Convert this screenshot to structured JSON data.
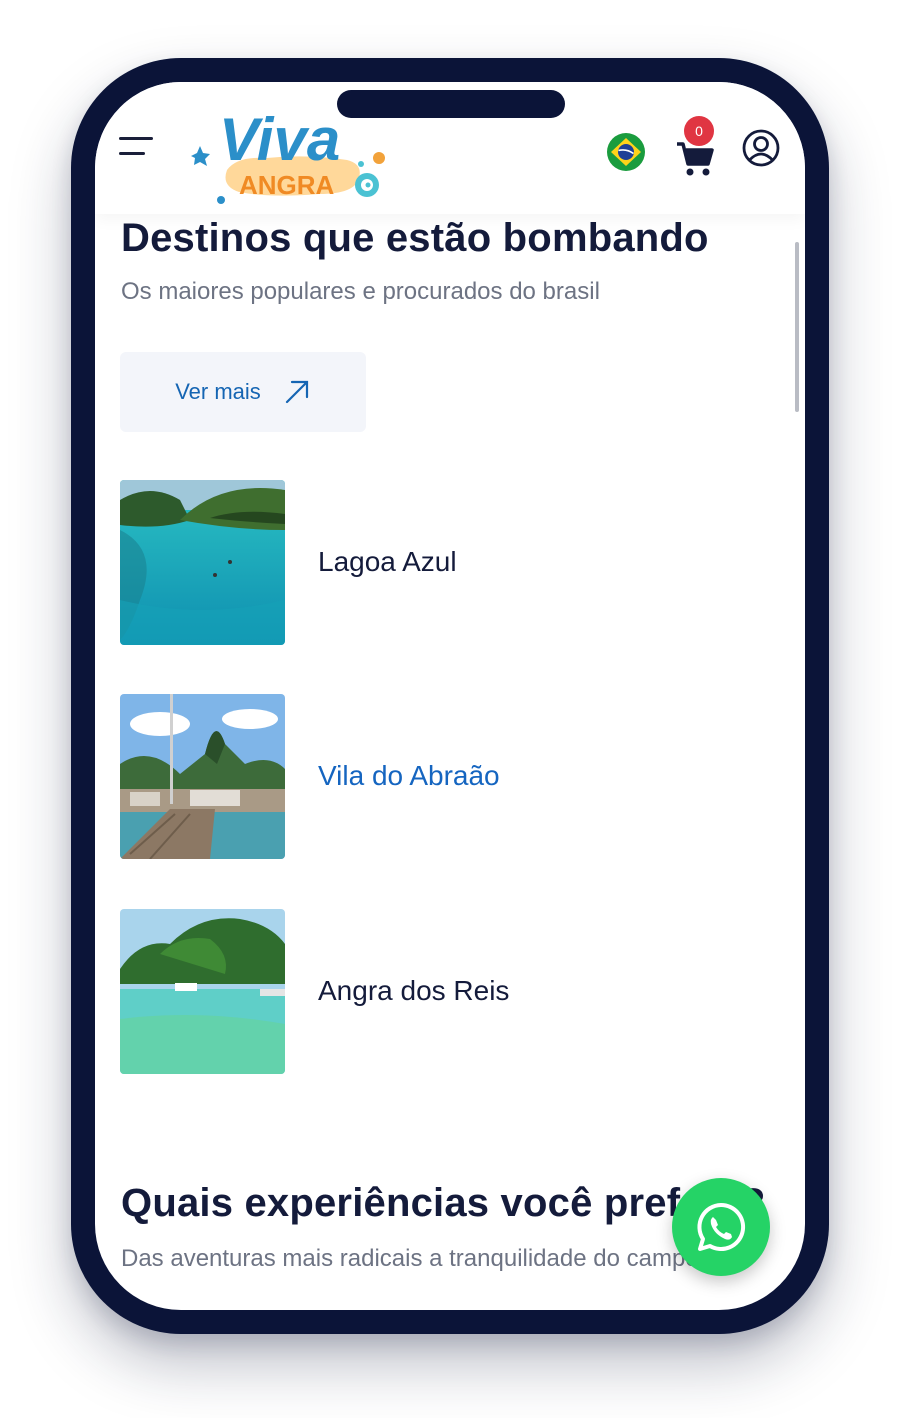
{
  "header": {
    "logo_text": "Viva",
    "logo_subtext": "ANGRA",
    "cart_count": "0"
  },
  "section1": {
    "title": "Destinos que estão bombando",
    "subtitle": "Os maiores populares e procurados do brasil",
    "button_label": "Ver mais"
  },
  "destinations": [
    {
      "name": "Lagoa Azul",
      "active": false
    },
    {
      "name": "Vila do Abraão",
      "active": true
    },
    {
      "name": "Angra dos Reis",
      "active": false
    }
  ],
  "section2": {
    "title": "Quais experiências você prefere?",
    "subtitle": "Das aventuras mais radicais a tranquilidade do campo"
  },
  "colors": {
    "frame": "#0b1438",
    "heading": "#141b3b",
    "link": "#1565c0",
    "badge": "#e03542",
    "whatsapp": "#25d366"
  },
  "icons": [
    "menu-icon",
    "brazil-flag-icon",
    "cart-icon",
    "user-icon",
    "arrow-up-right-icon",
    "whatsapp-icon"
  ]
}
